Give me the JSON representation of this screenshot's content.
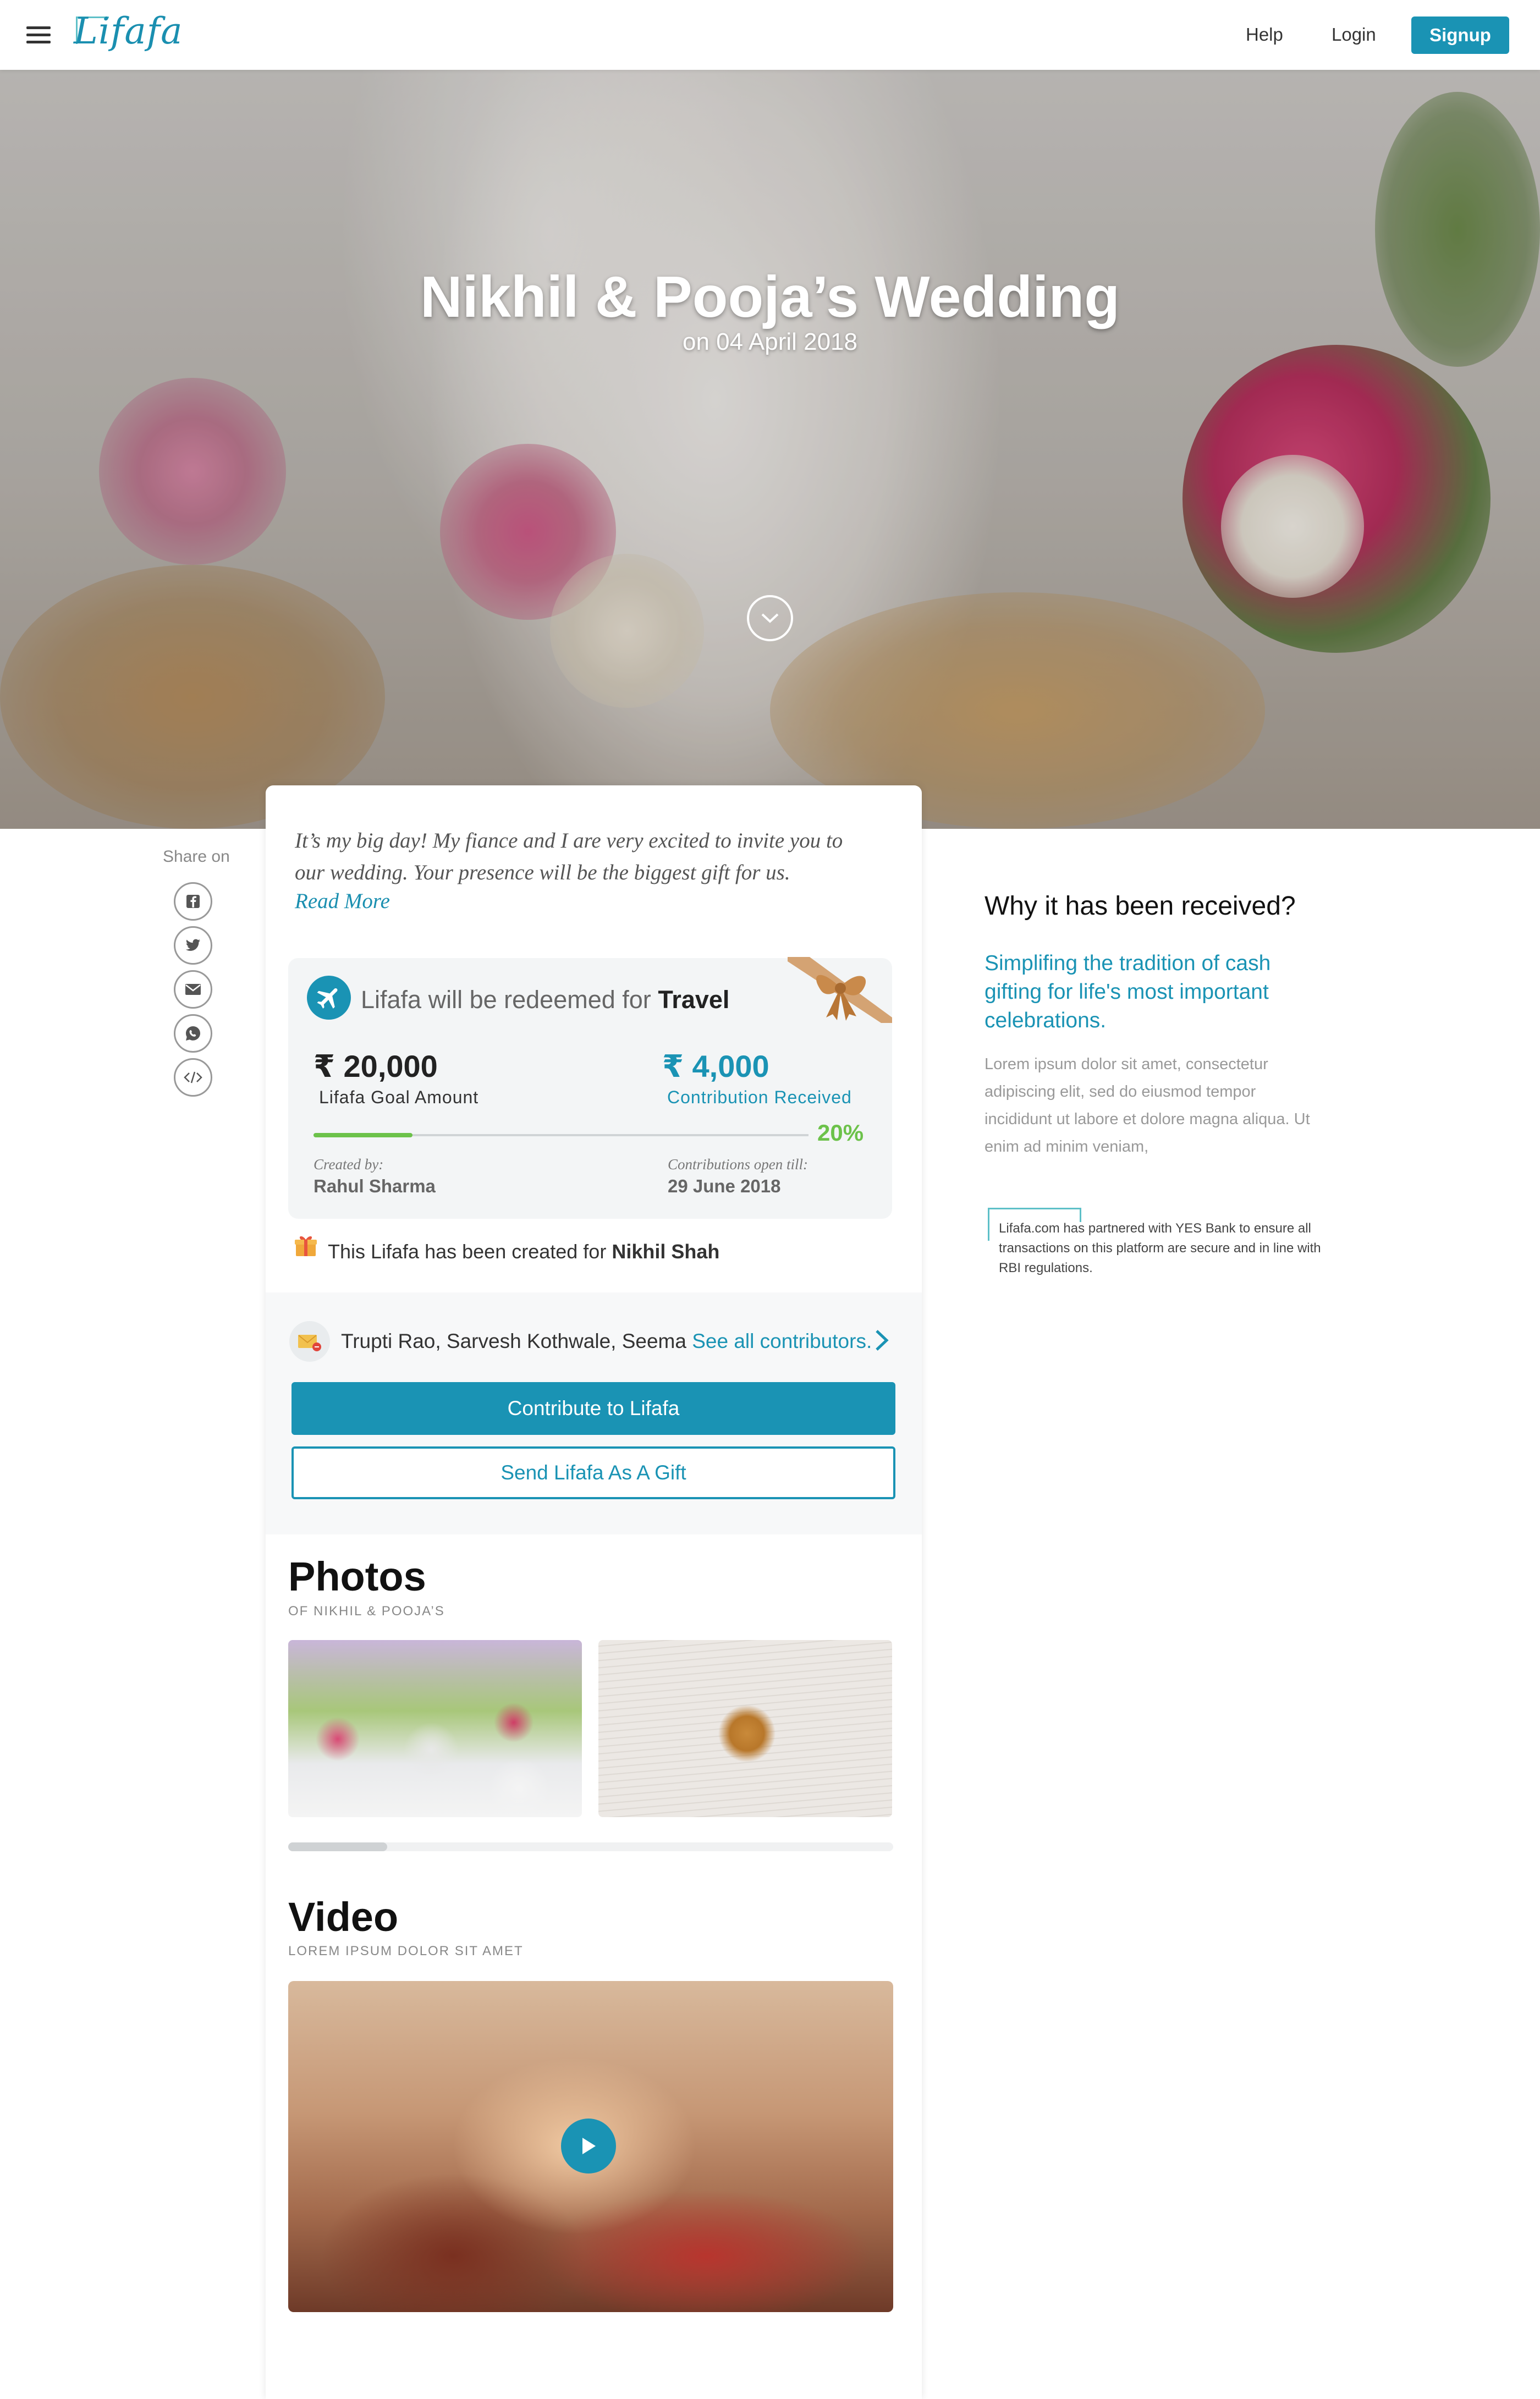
{
  "header": {
    "logo_text": "Lifafa",
    "nav": {
      "help": "Help",
      "login": "Login",
      "signup": "Signup"
    }
  },
  "hero": {
    "title": "Nikhil & Pooja’s Wedding",
    "date": "on 04 April 2018"
  },
  "share": {
    "label": "Share on",
    "icons": [
      "facebook-icon",
      "twitter-icon",
      "email-icon",
      "whatsapp-icon",
      "embed-icon"
    ]
  },
  "event": {
    "intro": "It’s my big day! My fiance and I are very excited to invite you to our wedding. Your presence will be the biggest gift for us.",
    "read_more": "Read More"
  },
  "goal_card": {
    "redeem_prefix": "Lifafa will be redeemed for",
    "redeem_for": "Travel",
    "goal_amount": "₹ 20,000",
    "goal_label": "Lifafa Goal Amount",
    "received_amount": "₹ 4,000",
    "received_label": "Contribution Received",
    "progress_percent": 20,
    "progress_text": "20%",
    "created_by_label": "Created by:",
    "created_by": "Rahul Sharma",
    "open_till_label": "Contributions open till:",
    "open_till": "29 June 2018"
  },
  "recipient": {
    "prefix": "This Lifafa has been created for",
    "name": "Nikhil Shah"
  },
  "contributors": {
    "names": "Trupti Rao, Sarvesh Kothwale, Seema",
    "see_all": "See all contributors."
  },
  "actions": {
    "contribute": "Contribute to Lifafa",
    "send_gift": "Send Lifafa As A Gift"
  },
  "photos": {
    "title": "Photos",
    "subtitle": "OF NIKHIL & POOJA’S"
  },
  "video": {
    "title": "Video",
    "subtitle": "LOREM IPSUM DOLOR SIT AMET"
  },
  "why": {
    "title": "Why it has been received?",
    "subtitle": "Simplifing the tradition of cash gifting for life's most important celebrations.",
    "body": "Lorem ipsum dolor sit amet, consectetur adipiscing elit, sed do eiusmod tempor incididunt ut labore et dolore magna aliqua. Ut enim ad minim veniam,",
    "partner_note": "Lifafa.com has partnered with YES Bank to ensure all transactions on this platform are secure and in line with RBI regulations."
  },
  "colors": {
    "accent": "#1a93b4",
    "progress": "#6cc24a",
    "logo_frame": "#5ec0c8"
  }
}
